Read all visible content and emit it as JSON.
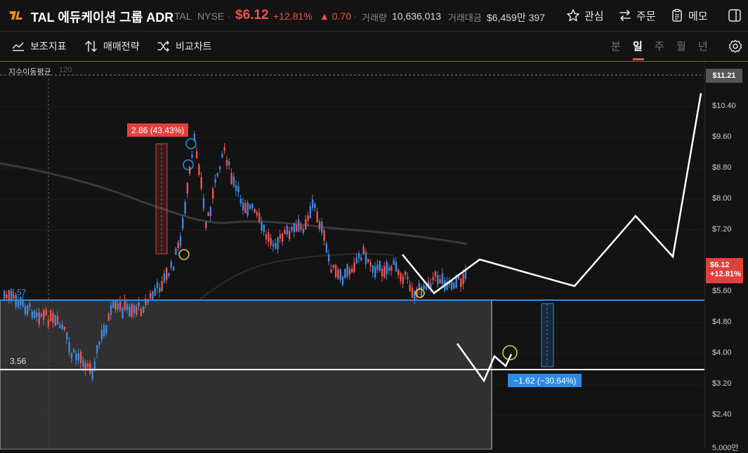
{
  "header": {
    "name": "TAL 에듀케이션 그룹 ADR",
    "ticker": "TAL",
    "exchange": "NYSE",
    "price": "$6.12",
    "change_pct": "+12.81%",
    "change_abs": "0.70",
    "volume_label": "거래량",
    "volume_value": "10,636,013",
    "amount_label": "거래대금",
    "amount_value": "$6,459만 397",
    "actions": {
      "watch": "관심",
      "order": "주문",
      "memo": "메모"
    }
  },
  "toolbar": {
    "indicators": "보조지표",
    "strategy": "매매전략",
    "compare": "비교차트",
    "periods": [
      "분",
      "일",
      "주",
      "월",
      "년"
    ],
    "active_period": "일"
  },
  "chart": {
    "ma_label": "지수이동평균",
    "ma_value": "120",
    "y_axis": [
      "$10.40",
      "$9.60",
      "$8.80",
      "$8.00",
      "$7.20",
      "$5.60",
      "$4.80",
      "$4.00",
      "$3.20",
      "$2.40"
    ],
    "axis_bottom": "5,000만",
    "tag_top": "$11.21",
    "tag_current_price": "$6.12",
    "tag_current_pct": "+12.81%",
    "level_low": "3.56",
    "level_high": "5.57",
    "measure_up": "2.86 (43.43%)",
    "measure_down": "−1.62 (−30.64%)"
  },
  "colors": {
    "up": "#f0514f",
    "down": "#3f86de",
    "level_line": "#2d8fe8",
    "background": "#131313"
  }
}
